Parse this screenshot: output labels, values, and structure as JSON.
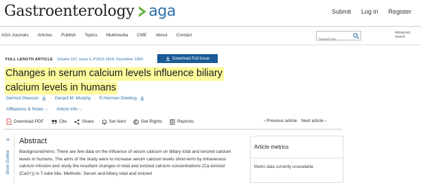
{
  "header": {
    "journal_name": "Gastroenterology",
    "publisher_logo_text": "aga",
    "links": [
      "Submit",
      "Log in",
      "Register"
    ]
  },
  "nav": {
    "items": [
      "AGA Journals",
      "Articles",
      "Publish",
      "Topics",
      "Multimedia",
      "CME",
      "About",
      "Contact"
    ],
    "search_placeholder": "Search for...",
    "advanced_search_label": "Advanced search"
  },
  "article": {
    "type": "FULL LENGTH ARTICLE",
    "volume": "Volume 107, Issue 6, P1812-1818, December 1994",
    "download_label": "Download Full Issue",
    "title_lines": [
      "Changes in serum calcium levels influence biliary",
      "calcium levels in humans"
    ],
    "authors": [
      "Dermot Gleeson",
      "Gerard M. Murphy",
      "R.Herman Dowling"
    ],
    "author_separator": "·",
    "affiliations_label": "Affiliations & Notes",
    "article_info_label": "Article Info"
  },
  "toolbar": {
    "items": [
      {
        "icon": "pdf-icon",
        "label": "Download PDF"
      },
      {
        "icon": "quote-icon",
        "label": "Cite"
      },
      {
        "icon": "share-icon",
        "label": "Share"
      },
      {
        "icon": "bell-icon",
        "label": "Set Alert"
      },
      {
        "icon": "copyright-icon",
        "label": "Get Rights"
      },
      {
        "icon": "reprints-icon",
        "label": "Reprints"
      }
    ],
    "previous_label": "Previous article",
    "next_label": "Next article"
  },
  "outline": {
    "label": "Show Outline"
  },
  "abstract": {
    "heading": "Abstract",
    "body": "Background/Aims: There are few data on the influence of serum calcium on biliary total and ionized calcium levels in humans. The aims of the study were to increase serum calcium levels short-term by intravenous calcium infusion and study the resultant changes in total and ionized calcium concentrations (Ca-ionized (Ca2+)) in T-tube bile. Methods: Serum and biliary total and ionized"
  },
  "metrics": {
    "title": "Article metrics",
    "text": "Metric data currently unavailable"
  },
  "colors": {
    "link_blue": "#2a6fa8",
    "button_blue": "#1a5a96",
    "highlight_yellow": "#fdfa9c"
  }
}
